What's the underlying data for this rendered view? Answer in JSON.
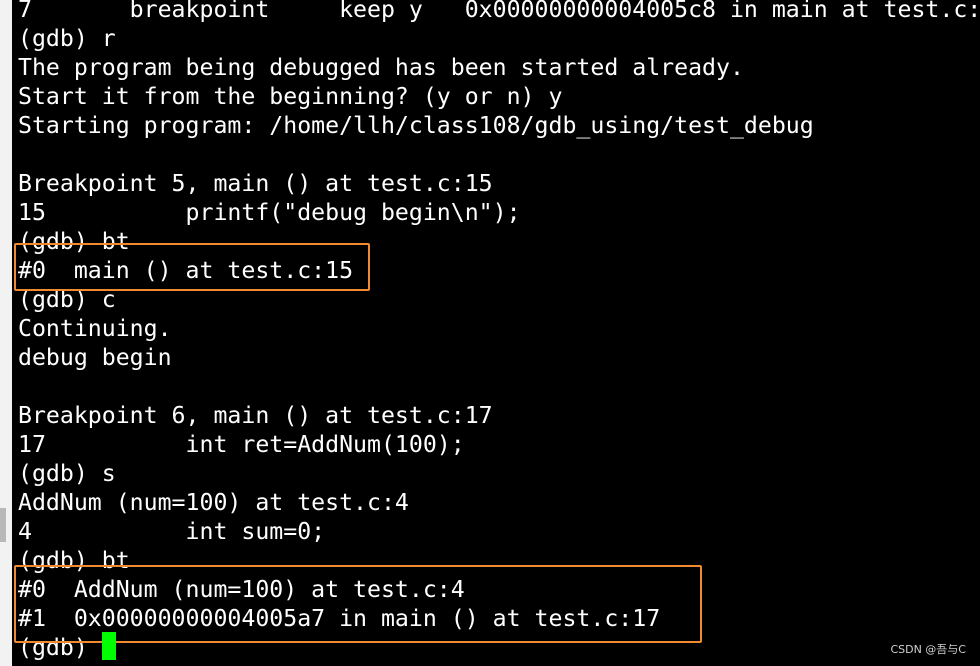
{
  "terminal": {
    "lines": [
      "7       breakpoint     keep y   0x00000000004005c8 in main at test.c:",
      "(gdb) r",
      "The program being debugged has been started already.",
      "Start it from the beginning? (y or n) y",
      "Starting program: /home/llh/class108/gdb_using/test_debug",
      "",
      "Breakpoint 5, main () at test.c:15",
      "15          printf(\"debug begin\\n\");",
      "(gdb) bt",
      "#0  main () at test.c:15",
      "(gdb) c",
      "Continuing.",
      "debug begin",
      "",
      "Breakpoint 6, main () at test.c:17",
      "17          int ret=AddNum(100);",
      "(gdb) s",
      "AddNum (num=100) at test.c:4",
      "4           int sum=0;",
      "(gdb) bt",
      "#0  AddNum (num=100) at test.c:4",
      "#1  0x00000000004005a7 in main () at test.c:17",
      "(gdb) "
    ]
  },
  "highlight_color": "#f08a30",
  "cursor_color": "#00ff00",
  "watermark": "CSDN @吾与C"
}
